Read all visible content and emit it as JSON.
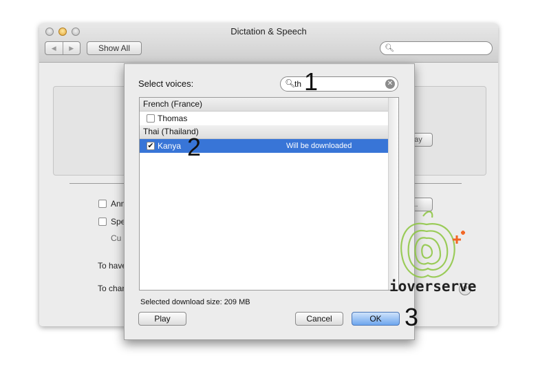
{
  "window": {
    "title": "Dictation & Speech",
    "back_glyph": "◀",
    "forward_glyph": "▶",
    "show_all_label": "Show All",
    "search_placeholder": "",
    "background_fragments": {
      "check1_text": "Ann",
      "check2_text": "Spe",
      "indented_text": "Cu",
      "line1_text": "To have",
      "line2_text": "To chang",
      "button1_label": "...",
      "button2_label": "Play"
    }
  },
  "sheet": {
    "select_voices_label": "Select voices:",
    "search_value": "th",
    "groups": [
      {
        "name": "French (France)",
        "voices": [
          {
            "name": "Thomas",
            "checked": false,
            "selected": false,
            "status": ""
          }
        ]
      },
      {
        "name": "Thai (Thailand)",
        "voices": [
          {
            "name": "Kanya",
            "checked": true,
            "selected": true,
            "status": "Will be downloaded"
          }
        ]
      }
    ],
    "download_size_text": "Selected download size: 209 MB",
    "play_label": "Play",
    "cancel_label": "Cancel",
    "ok_label": "OK"
  },
  "annotations": [
    "1",
    "2",
    "3"
  ],
  "watermark_text": "ioverserve",
  "colors": {
    "selection": "#3875d7",
    "default_button": "#6ea6ee",
    "watermark_green": "#8cc63f",
    "watermark_orange": "#f26522"
  }
}
